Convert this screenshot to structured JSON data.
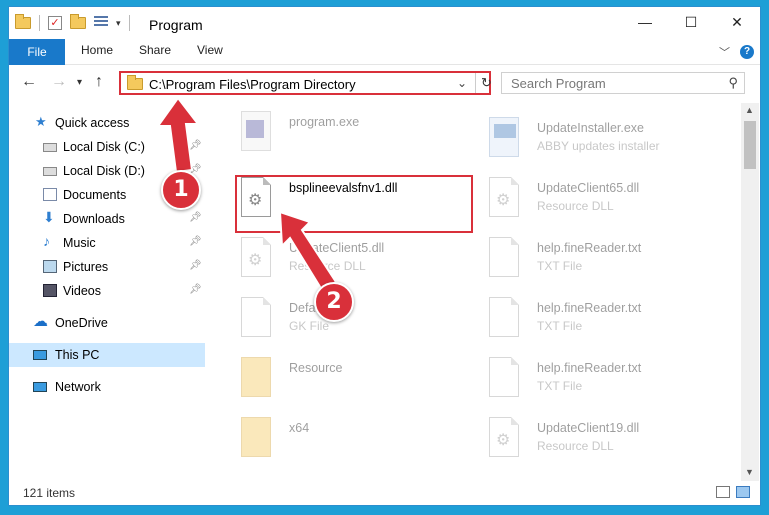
{
  "window": {
    "title": "Program",
    "controls": {
      "minimize": "—",
      "maximize": "☐",
      "close": "✕"
    }
  },
  "ribbon": {
    "tabs": [
      "File",
      "Home",
      "Share",
      "View"
    ],
    "expand_icon": "chevron-down-icon",
    "help_glyph": "?"
  },
  "address_bar": {
    "path": "C:\\Program Files\\Program Directory",
    "refresh_glyph": "↻"
  },
  "search": {
    "placeholder": "Search Program"
  },
  "sidebar": {
    "items": [
      {
        "label": "Quick access",
        "icon": "star-icon",
        "pinned": false
      },
      {
        "label": "Local Disk (C:)",
        "icon": "drive-icon",
        "pinned": true
      },
      {
        "label": "Local Disk (D:)",
        "icon": "drive-icon",
        "pinned": true
      },
      {
        "label": "Documents",
        "icon": "documents-icon",
        "pinned": true
      },
      {
        "label": "Downloads",
        "icon": "download-icon",
        "pinned": true
      },
      {
        "label": "Music",
        "icon": "music-icon",
        "pinned": true
      },
      {
        "label": "Pictures",
        "icon": "pictures-icon",
        "pinned": true
      },
      {
        "label": "Videos",
        "icon": "videos-icon",
        "pinned": true
      },
      {
        "label": "OneDrive",
        "icon": "cloud-icon",
        "pinned": false
      },
      {
        "label": "This PC",
        "icon": "computer-icon",
        "pinned": false,
        "selected": true
      },
      {
        "label": "Network",
        "icon": "network-icon",
        "pinned": false
      }
    ]
  },
  "files": {
    "left": [
      {
        "name": "program.exe",
        "type": "",
        "icon": "exe-icon"
      },
      {
        "name": "bsplineevalsfnv1.dll",
        "type": "",
        "icon": "dll-gear-icon",
        "highlighted": true
      },
      {
        "name": "UpdateClient5.dll",
        "type": "Resource DLL",
        "icon": "dll-gear-icon"
      },
      {
        "name": "Default.gk",
        "type": "GK File",
        "icon": "file-icon"
      },
      {
        "name": "Resource",
        "type": "",
        "icon": "folder-icon"
      },
      {
        "name": "x64",
        "type": "",
        "icon": "folder-icon"
      }
    ],
    "right": [
      {
        "name": "UpdateInstaller.exe",
        "type": "ABBY updates installer",
        "icon": "installer-icon"
      },
      {
        "name": "UpdateClient65.dll",
        "type": "Resource DLL",
        "icon": "dll-gear-icon"
      },
      {
        "name": "help.fineReader.txt",
        "type": "TXT File",
        "icon": "text-file-icon"
      },
      {
        "name": "help.fineReader.txt",
        "type": "TXT File",
        "icon": "text-file-icon"
      },
      {
        "name": "help.fineReader.txt",
        "type": "TXT File",
        "icon": "text-file-icon"
      },
      {
        "name": "UpdateClient19.dll",
        "type": "Resource DLL",
        "icon": "dll-gear-icon"
      }
    ]
  },
  "status": {
    "items_count": "121 items"
  },
  "annotations": {
    "step1": "1",
    "step2": "2"
  },
  "colors": {
    "accent": "#1979ca",
    "highlight": "#d9303a",
    "selection": "#cce8ff",
    "desktop": "#1e9fd6"
  }
}
